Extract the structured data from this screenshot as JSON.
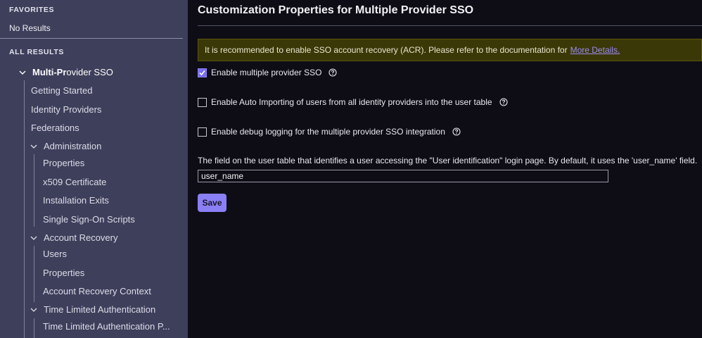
{
  "sidebar": {
    "favorites_header": "FAVORITES",
    "favorites_empty": "No Results",
    "all_results_header": "ALL RESULTS",
    "top": {
      "label_bold": "Multi-Pr",
      "label_rest": "ovider SSO"
    },
    "items": {
      "getting_started": "Getting Started",
      "identity_providers": "Identity Providers",
      "federations": "Federations",
      "administration": "Administration",
      "properties": "Properties",
      "x509": "x509 Certificate",
      "installation_exits": "Installation Exits",
      "sso_scripts": "Single Sign-On Scripts",
      "account_recovery": "Account Recovery",
      "users": "Users",
      "ar_properties": "Properties",
      "ar_context": "Account Recovery Context",
      "tla": "Time Limited Authentication",
      "tla_p": "Time Limited Authentication P..."
    }
  },
  "main": {
    "title": "Customization Properties for Multiple Provider SSO",
    "banner_text": "It is recommended to enable SSO account recovery (ACR). Please refer to the documentation for",
    "banner_link": "More Details.",
    "checkboxes": {
      "enable_multi": "Enable multiple provider SSO",
      "auto_import": "Enable Auto Importing of users from all identity providers into the user table",
      "debug_logging": "Enable debug logging for the multiple provider SSO integration"
    },
    "field_label": "The field on the user table that identifies a user accessing the \"User identification\" login page. By default, it uses the 'user_name' field.",
    "field_value": "user_name",
    "save_label": "Save"
  },
  "colors": {
    "sidebar_bg": "#3e3f5b",
    "main_bg": "#0e0d15",
    "accent": "#8a7ff5",
    "banner_bg": "#3b3807"
  },
  "icons": {
    "chevron": "chevron-down-icon",
    "help": "help-circle-icon",
    "check": "check-icon"
  }
}
